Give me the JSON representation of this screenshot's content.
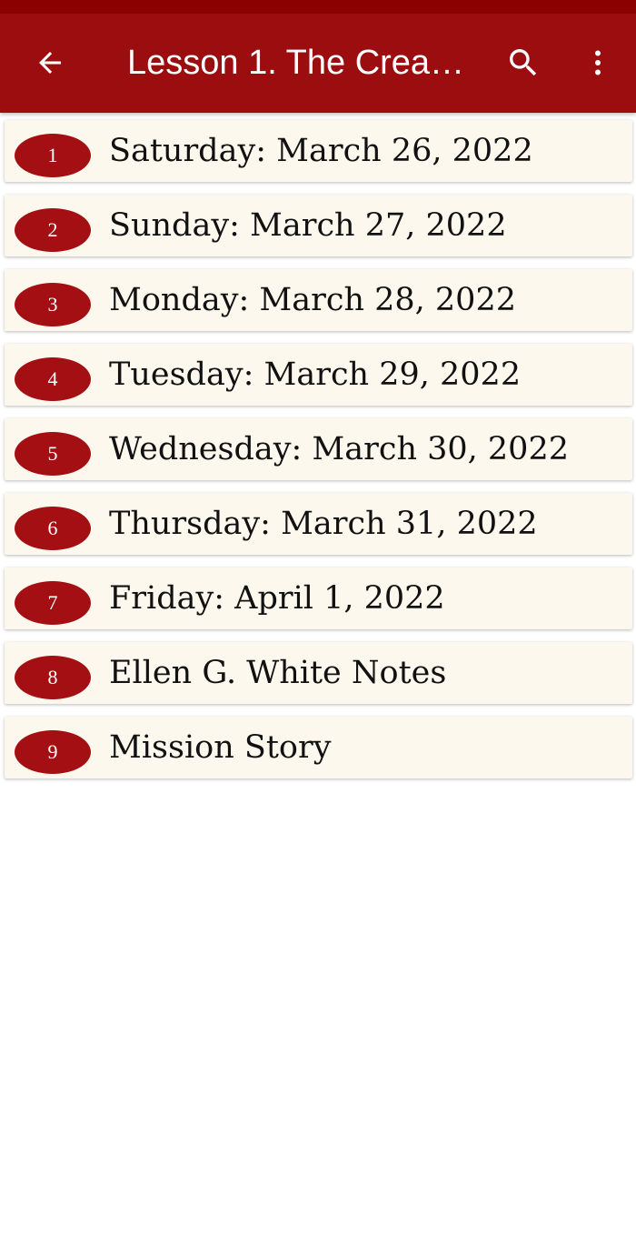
{
  "app_bar": {
    "title": "Lesson 1. The Crea…",
    "back_icon": "arrow-left-icon",
    "search_icon": "search-icon",
    "more_icon": "more-vertical-icon"
  },
  "colors": {
    "status_bar": "#8b0000",
    "app_bar": "#9b0d0f",
    "badge": "#a30f12",
    "item_background": "#fdf8ee"
  },
  "items": [
    {
      "number": "1",
      "label": "Saturday: March 26, 2022"
    },
    {
      "number": "2",
      "label": "Sunday: March 27, 2022"
    },
    {
      "number": "3",
      "label": "Monday: March 28, 2022"
    },
    {
      "number": "4",
      "label": "Tuesday: March 29, 2022"
    },
    {
      "number": "5",
      "label": "Wednesday: March 30, 2022"
    },
    {
      "number": "6",
      "label": "Thursday: March 31, 2022"
    },
    {
      "number": "7",
      "label": "Friday: April 1, 2022"
    },
    {
      "number": "8",
      "label": "Ellen G. White Notes"
    },
    {
      "number": "9",
      "label": "Mission Story"
    }
  ]
}
